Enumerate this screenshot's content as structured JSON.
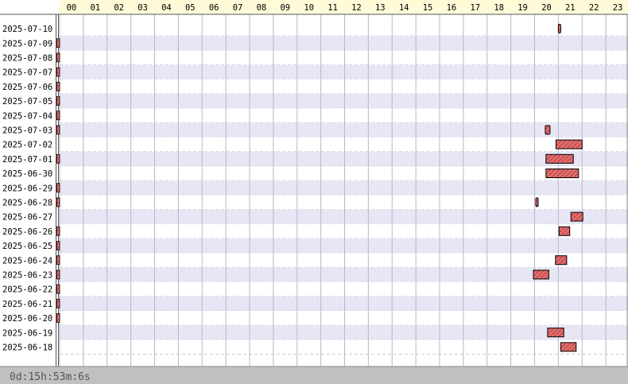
{
  "hour_labels": [
    "00",
    "01",
    "02",
    "03",
    "04",
    "05",
    "06",
    "07",
    "08",
    "09",
    "10",
    "11",
    "12",
    "13",
    "14",
    "15",
    "16",
    "17",
    "18",
    "19",
    "20",
    "21",
    "22",
    "23"
  ],
  "colors": {
    "header_bg": "#fffbd9",
    "row_alt": "#e6e6f5",
    "row_base": "#ffffff",
    "bar_fill": "#e46c6c",
    "bar_stroke": "#000000",
    "footer_bg": "#c0c0c0",
    "footer_text": "#555555"
  },
  "rows": [
    {
      "date": "2025-07-10",
      "sessions": [
        [
          21.0,
          21.1
        ]
      ],
      "has_marker": false
    },
    {
      "date": "2025-07-09",
      "sessions": [],
      "has_marker": true
    },
    {
      "date": "2025-07-08",
      "sessions": [],
      "has_marker": true
    },
    {
      "date": "2025-07-07",
      "sessions": [],
      "has_marker": true
    },
    {
      "date": "2025-07-06",
      "sessions": [],
      "has_marker": true
    },
    {
      "date": "2025-07-05",
      "sessions": [],
      "has_marker": true
    },
    {
      "date": "2025-07-04",
      "sessions": [],
      "has_marker": true
    },
    {
      "date": "2025-07-03",
      "sessions": [
        [
          20.45,
          20.65
        ]
      ],
      "has_marker": true
    },
    {
      "date": "2025-07-02",
      "sessions": [
        [
          20.9,
          22.0
        ]
      ],
      "has_marker": false
    },
    {
      "date": "2025-07-01",
      "sessions": [
        [
          20.48,
          21.63
        ]
      ],
      "has_marker": true
    },
    {
      "date": "2025-06-30",
      "sessions": [
        [
          20.48,
          21.85
        ]
      ],
      "has_marker": false
    },
    {
      "date": "2025-06-29",
      "sessions": [],
      "has_marker": true
    },
    {
      "date": "2025-06-28",
      "sessions": [
        [
          20.05,
          20.13
        ]
      ],
      "has_marker": true
    },
    {
      "date": "2025-06-27",
      "sessions": [
        [
          21.53,
          22.03
        ]
      ],
      "has_marker": false
    },
    {
      "date": "2025-06-26",
      "sessions": [
        [
          21.03,
          21.48
        ]
      ],
      "has_marker": true
    },
    {
      "date": "2025-06-25",
      "sessions": [],
      "has_marker": true
    },
    {
      "date": "2025-06-24",
      "sessions": [
        [
          20.88,
          21.35
        ]
      ],
      "has_marker": true
    },
    {
      "date": "2025-06-23",
      "sessions": [
        [
          19.95,
          20.6
        ]
      ],
      "has_marker": true
    },
    {
      "date": "2025-06-22",
      "sessions": [],
      "has_marker": true
    },
    {
      "date": "2025-06-21",
      "sessions": [],
      "has_marker": true
    },
    {
      "date": "2025-06-20",
      "sessions": [],
      "has_marker": true
    },
    {
      "date": "2025-06-19",
      "sessions": [
        [
          20.55,
          21.23
        ]
      ],
      "has_marker": false
    },
    {
      "date": "2025-06-18",
      "sessions": [
        [
          21.1,
          21.75
        ]
      ],
      "has_marker": false
    }
  ],
  "footer": {
    "total_time": "0d:15h:53m:6s"
  }
}
